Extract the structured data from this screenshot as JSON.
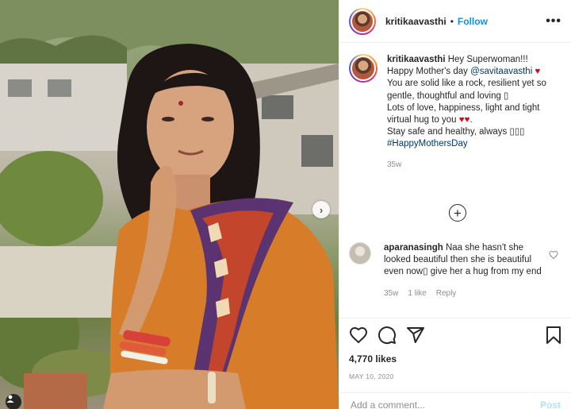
{
  "header": {
    "username": "kritikaavasthi",
    "separator": "•",
    "follow_label": "Follow",
    "more_label": "•••"
  },
  "caption": {
    "username": "kritikaavasthi",
    "text_1": " Hey Superwoman!!!",
    "text_2": "Happy Mother's day ",
    "mention": "@savitaavasthi",
    "heart_1": " ♥",
    "text_3": "You are solid like a rock, resilient yet so gentle, thoughtful and loving ▯",
    "text_4": "Lots of love, happiness, light and tight virtual hug to you ",
    "hearts_2": "♥♥",
    "text_4_end": ".",
    "text_5": "Stay safe and healthy, always ▯▯▯",
    "hashtag": "#HappyMothersDay",
    "time": "35w"
  },
  "load_more_label": "+",
  "comment": {
    "username": "aparanasingh",
    "text": " Naa she hasn't she looked beautiful then she is beautiful even now▯ give her a hug from my end",
    "time": "35w",
    "likes": "1 like",
    "reply": "Reply"
  },
  "post": {
    "likes": "4,770 likes",
    "date": "MAY 10, 2020"
  },
  "add_comment": {
    "placeholder": "Add a comment...",
    "post_label": "Post"
  },
  "colors": {
    "link": "#0095f6",
    "mention": "#00376b",
    "heart": "#c0112b",
    "muted": "#8e8e8e"
  },
  "icons": [
    "heart-icon",
    "comment-icon",
    "share-icon",
    "bookmark-icon",
    "plus-circle-icon",
    "chevron-right-icon",
    "user-tag-icon",
    "more-options-icon"
  ]
}
